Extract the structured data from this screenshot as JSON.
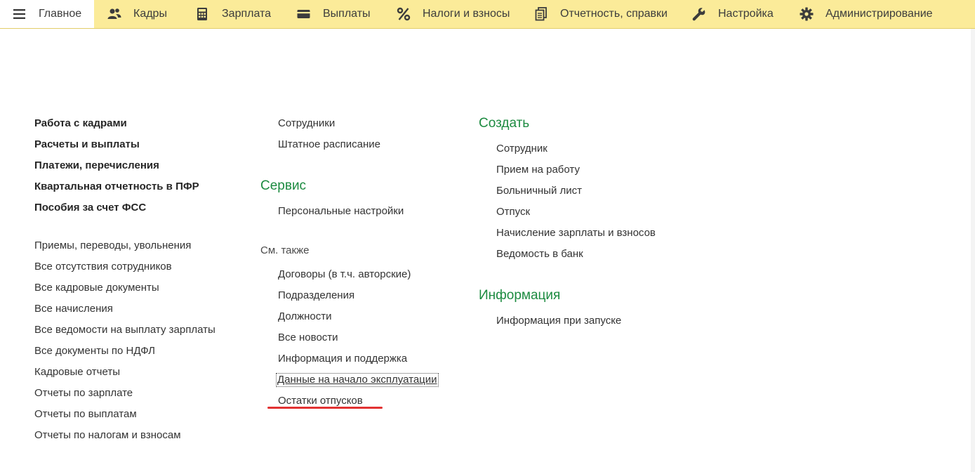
{
  "topbar": {
    "tabs": [
      {
        "label": "Главное",
        "icon": "menu-icon",
        "active": true
      },
      {
        "label": "Кадры",
        "icon": "people-icon",
        "active": false
      },
      {
        "label": "Зарплата",
        "icon": "calculator-icon",
        "active": false
      },
      {
        "label": "Выплаты",
        "icon": "wallet-icon",
        "active": false
      },
      {
        "label": "Налоги и взносы",
        "icon": "percent-icon",
        "active": false
      },
      {
        "label": "Отчетность, справки",
        "icon": "documents-icon",
        "active": false
      },
      {
        "label": "Настройка",
        "icon": "wrench-icon",
        "active": false
      },
      {
        "label": "Администрирование",
        "icon": "gear-icon",
        "active": false
      }
    ]
  },
  "left_column": {
    "sections": [
      "Работа с кадрами",
      "Расчеты и выплаты",
      "Платежи, перечисления",
      "Квартальная отчетность в ПФР",
      "Пособия за счет ФСС"
    ],
    "links": [
      "Приемы, переводы, увольнения",
      "Все отсутствия сотрудников",
      "Все кадровые документы",
      "Все начисления",
      "Все ведомости на выплату зарплаты",
      "Все документы по НДФЛ",
      "Кадровые отчеты",
      "Отчеты по зарплате",
      "Отчеты по выплатам",
      "Отчеты по налогам и взносам"
    ]
  },
  "middle_column": {
    "top_links": [
      "Сотрудники",
      "Штатное расписание"
    ],
    "service_title": "Сервис",
    "service_links": [
      "Персональные настройки"
    ],
    "see_also_title": "См. также",
    "see_also_links": [
      "Договоры (в т.ч. авторские)",
      "Подразделения",
      "Должности",
      "Все новости",
      "Информация и поддержка",
      "Данные на начало эксплуатации",
      "Остатки отпусков"
    ]
  },
  "right_column": {
    "create_title": "Создать",
    "create_links": [
      "Сотрудник",
      "Прием на работу",
      "Больничный лист",
      "Отпуск",
      "Начисление зарплаты и взносов",
      "Ведомость в банк"
    ],
    "info_title": "Информация",
    "info_links": [
      "Информация при запуске"
    ]
  },
  "colors": {
    "topbar_bg": "#fbeb99",
    "section_green": "#1d8b41",
    "annotation_red": "#e23232"
  }
}
